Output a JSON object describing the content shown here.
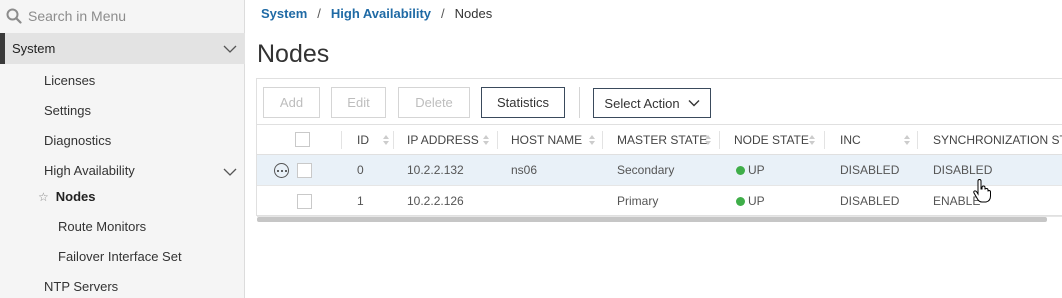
{
  "sidebar": {
    "search_placeholder": "Search in Menu",
    "section": "System",
    "items": [
      {
        "label": "Licenses"
      },
      {
        "label": "Settings"
      },
      {
        "label": "Diagnostics"
      },
      {
        "label": "High Availability"
      },
      {
        "label": "Nodes"
      },
      {
        "label": "Route Monitors"
      },
      {
        "label": "Failover Interface Set"
      },
      {
        "label": "NTP Servers"
      }
    ]
  },
  "breadcrumb": {
    "items": [
      "System",
      "High Availability",
      "Nodes"
    ],
    "separator": "/"
  },
  "page": {
    "title": "Nodes"
  },
  "toolbar": {
    "add": "Add",
    "edit": "Edit",
    "delete": "Delete",
    "statistics": "Statistics",
    "select_action": "Select Action"
  },
  "table": {
    "columns": [
      "ID",
      "IP ADDRESS",
      "HOST NAME",
      "MASTER STATE",
      "NODE STATE",
      "INC",
      "SYNCHRONIZATION STA"
    ],
    "rows": [
      {
        "id": "0",
        "ip": "10.2.2.132",
        "host": "ns06",
        "master_state": "Secondary",
        "node_state": "UP",
        "inc": "DISABLED",
        "sync": "DISABLED"
      },
      {
        "id": "1",
        "ip": "10.2.2.126",
        "host": "",
        "master_state": "Primary",
        "node_state": "UP",
        "inc": "DISABLED",
        "sync": "ENABLE"
      }
    ]
  },
  "colors": {
    "accent": "#1f6aa5",
    "status_up": "#3fae49",
    "selected_row": "#e9f1f8"
  }
}
